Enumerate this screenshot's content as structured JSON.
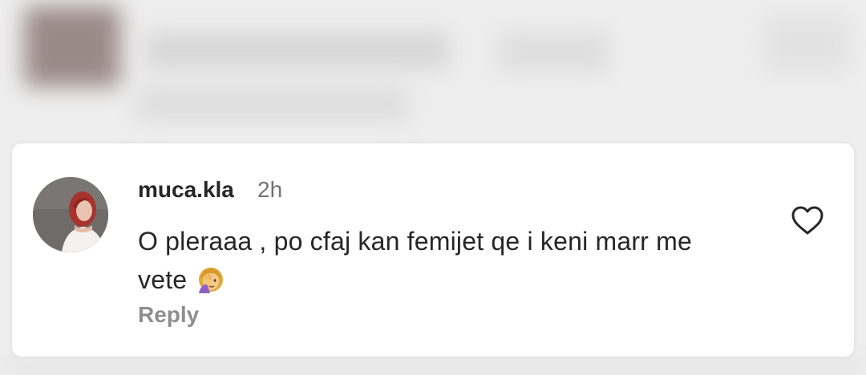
{
  "comment": {
    "username": "muca.kla",
    "time": "2h",
    "text": "O pleraaa , po cfaj kan femijet qe i keni marr me vete",
    "emoji_icon": "face-palm-icon",
    "reply_label": "Reply",
    "like_icon": "heart-outline-icon"
  },
  "colors": {
    "text_primary": "#262626",
    "text_secondary": "#737373",
    "reply_text": "#8e8e8e",
    "card_background": "#ffffff",
    "page_background": "#eeeeee"
  }
}
